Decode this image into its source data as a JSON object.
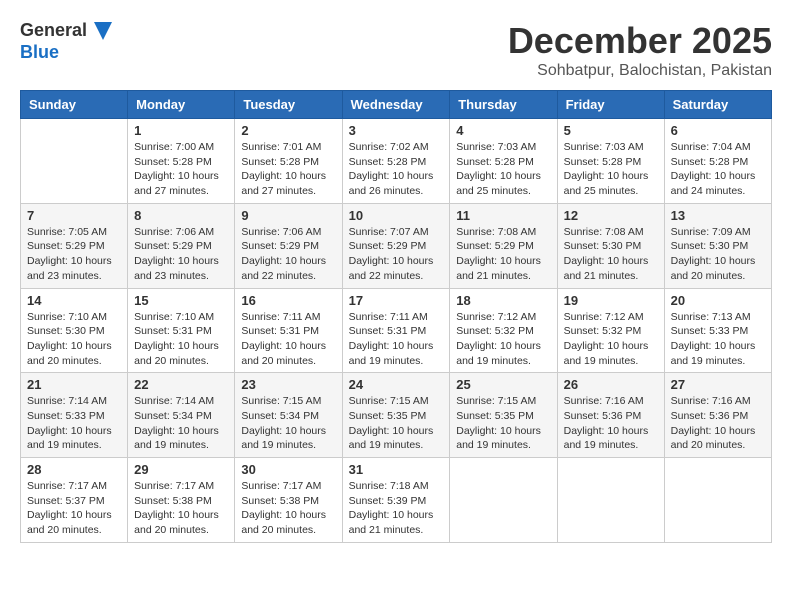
{
  "logo": {
    "line1": "General",
    "line2": "Blue"
  },
  "title": "December 2025",
  "location": "Sohbatpur, Balochistan, Pakistan",
  "weekdays": [
    "Sunday",
    "Monday",
    "Tuesday",
    "Wednesday",
    "Thursday",
    "Friday",
    "Saturday"
  ],
  "weeks": [
    [
      {
        "day": "",
        "info": ""
      },
      {
        "day": "1",
        "info": "Sunrise: 7:00 AM\nSunset: 5:28 PM\nDaylight: 10 hours\nand 27 minutes."
      },
      {
        "day": "2",
        "info": "Sunrise: 7:01 AM\nSunset: 5:28 PM\nDaylight: 10 hours\nand 27 minutes."
      },
      {
        "day": "3",
        "info": "Sunrise: 7:02 AM\nSunset: 5:28 PM\nDaylight: 10 hours\nand 26 minutes."
      },
      {
        "day": "4",
        "info": "Sunrise: 7:03 AM\nSunset: 5:28 PM\nDaylight: 10 hours\nand 25 minutes."
      },
      {
        "day": "5",
        "info": "Sunrise: 7:03 AM\nSunset: 5:28 PM\nDaylight: 10 hours\nand 25 minutes."
      },
      {
        "day": "6",
        "info": "Sunrise: 7:04 AM\nSunset: 5:28 PM\nDaylight: 10 hours\nand 24 minutes."
      }
    ],
    [
      {
        "day": "7",
        "info": "Sunrise: 7:05 AM\nSunset: 5:29 PM\nDaylight: 10 hours\nand 23 minutes."
      },
      {
        "day": "8",
        "info": "Sunrise: 7:06 AM\nSunset: 5:29 PM\nDaylight: 10 hours\nand 23 minutes."
      },
      {
        "day": "9",
        "info": "Sunrise: 7:06 AM\nSunset: 5:29 PM\nDaylight: 10 hours\nand 22 minutes."
      },
      {
        "day": "10",
        "info": "Sunrise: 7:07 AM\nSunset: 5:29 PM\nDaylight: 10 hours\nand 22 minutes."
      },
      {
        "day": "11",
        "info": "Sunrise: 7:08 AM\nSunset: 5:29 PM\nDaylight: 10 hours\nand 21 minutes."
      },
      {
        "day": "12",
        "info": "Sunrise: 7:08 AM\nSunset: 5:30 PM\nDaylight: 10 hours\nand 21 minutes."
      },
      {
        "day": "13",
        "info": "Sunrise: 7:09 AM\nSunset: 5:30 PM\nDaylight: 10 hours\nand 20 minutes."
      }
    ],
    [
      {
        "day": "14",
        "info": "Sunrise: 7:10 AM\nSunset: 5:30 PM\nDaylight: 10 hours\nand 20 minutes."
      },
      {
        "day": "15",
        "info": "Sunrise: 7:10 AM\nSunset: 5:31 PM\nDaylight: 10 hours\nand 20 minutes."
      },
      {
        "day": "16",
        "info": "Sunrise: 7:11 AM\nSunset: 5:31 PM\nDaylight: 10 hours\nand 20 minutes."
      },
      {
        "day": "17",
        "info": "Sunrise: 7:11 AM\nSunset: 5:31 PM\nDaylight: 10 hours\nand 19 minutes."
      },
      {
        "day": "18",
        "info": "Sunrise: 7:12 AM\nSunset: 5:32 PM\nDaylight: 10 hours\nand 19 minutes."
      },
      {
        "day": "19",
        "info": "Sunrise: 7:12 AM\nSunset: 5:32 PM\nDaylight: 10 hours\nand 19 minutes."
      },
      {
        "day": "20",
        "info": "Sunrise: 7:13 AM\nSunset: 5:33 PM\nDaylight: 10 hours\nand 19 minutes."
      }
    ],
    [
      {
        "day": "21",
        "info": "Sunrise: 7:14 AM\nSunset: 5:33 PM\nDaylight: 10 hours\nand 19 minutes."
      },
      {
        "day": "22",
        "info": "Sunrise: 7:14 AM\nSunset: 5:34 PM\nDaylight: 10 hours\nand 19 minutes."
      },
      {
        "day": "23",
        "info": "Sunrise: 7:15 AM\nSunset: 5:34 PM\nDaylight: 10 hours\nand 19 minutes."
      },
      {
        "day": "24",
        "info": "Sunrise: 7:15 AM\nSunset: 5:35 PM\nDaylight: 10 hours\nand 19 minutes."
      },
      {
        "day": "25",
        "info": "Sunrise: 7:15 AM\nSunset: 5:35 PM\nDaylight: 10 hours\nand 19 minutes."
      },
      {
        "day": "26",
        "info": "Sunrise: 7:16 AM\nSunset: 5:36 PM\nDaylight: 10 hours\nand 19 minutes."
      },
      {
        "day": "27",
        "info": "Sunrise: 7:16 AM\nSunset: 5:36 PM\nDaylight: 10 hours\nand 20 minutes."
      }
    ],
    [
      {
        "day": "28",
        "info": "Sunrise: 7:17 AM\nSunset: 5:37 PM\nDaylight: 10 hours\nand 20 minutes."
      },
      {
        "day": "29",
        "info": "Sunrise: 7:17 AM\nSunset: 5:38 PM\nDaylight: 10 hours\nand 20 minutes."
      },
      {
        "day": "30",
        "info": "Sunrise: 7:17 AM\nSunset: 5:38 PM\nDaylight: 10 hours\nand 20 minutes."
      },
      {
        "day": "31",
        "info": "Sunrise: 7:18 AM\nSunset: 5:39 PM\nDaylight: 10 hours\nand 21 minutes."
      },
      {
        "day": "",
        "info": ""
      },
      {
        "day": "",
        "info": ""
      },
      {
        "day": "",
        "info": ""
      }
    ]
  ]
}
